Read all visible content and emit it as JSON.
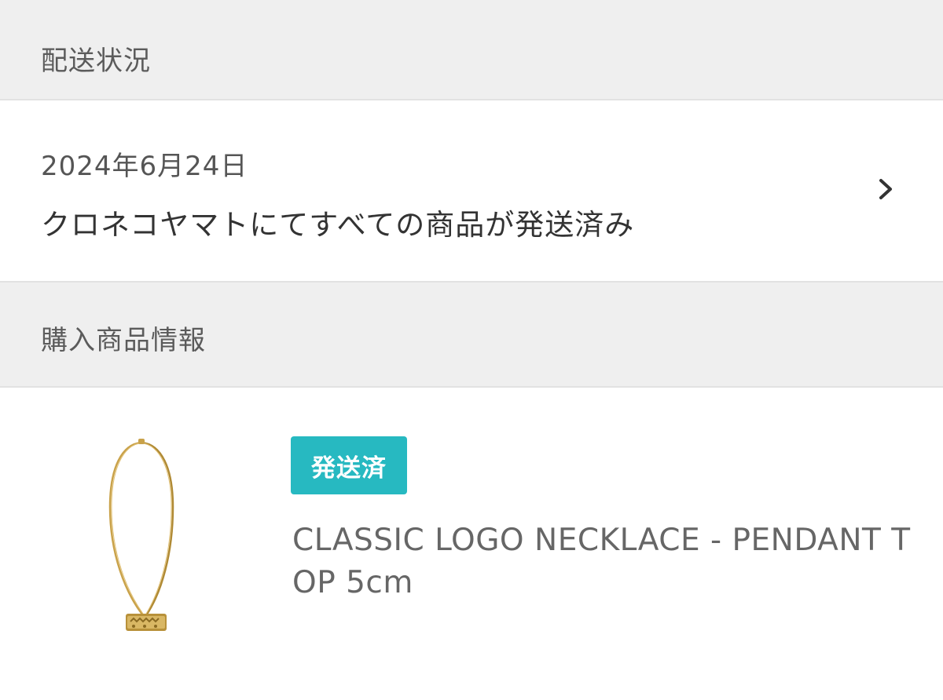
{
  "shipping_section": {
    "title": "配送状況"
  },
  "shipping_status": {
    "date": "2024年6月24日",
    "message": "クロネコヤマトにてすべての商品が発送済み",
    "chevron_icon": "chevron-right-icon"
  },
  "purchase_section": {
    "title": "購入商品情報"
  },
  "product": {
    "status_badge": "発送済",
    "badge_color": "#27b9c1",
    "name": "CLASSIC LOGO NECKLACE - PENDANT TOP 5cm",
    "image_icon": "necklace-image"
  }
}
